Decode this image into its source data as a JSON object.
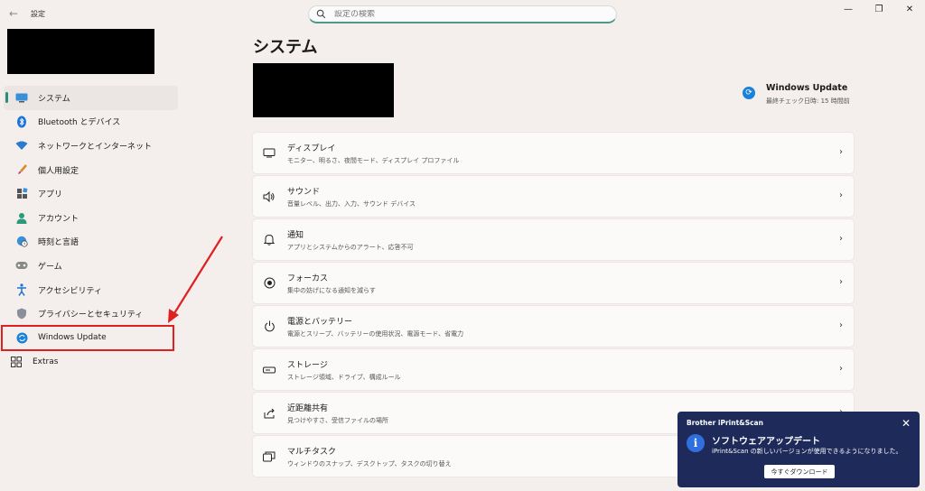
{
  "app": {
    "title": "設定",
    "back_icon": "arrow-left-icon",
    "window_controls": [
      "minimize-icon",
      "maximize-icon",
      "close-icon"
    ]
  },
  "search": {
    "placeholder": "設定の検索",
    "icon": "search-icon"
  },
  "sidebar": {
    "items": [
      {
        "label": "システム",
        "icon": "monitor-icon",
        "active": true
      },
      {
        "label": "Bluetooth とデバイス",
        "icon": "bluetooth-icon"
      },
      {
        "label": "ネットワークとインターネット",
        "icon": "wifi-icon"
      },
      {
        "label": "個人用設定",
        "icon": "brush-icon"
      },
      {
        "label": "アプリ",
        "icon": "apps-icon"
      },
      {
        "label": "アカウント",
        "icon": "person-icon"
      },
      {
        "label": "時刻と言語",
        "icon": "globe-clock-icon"
      },
      {
        "label": "ゲーム",
        "icon": "gamepad-icon"
      },
      {
        "label": "アクセシビリティ",
        "icon": "accessibility-icon"
      },
      {
        "label": "プライバシーとセキュリティ",
        "icon": "shield-icon"
      },
      {
        "label": "Windows Update",
        "icon": "windows-update-icon"
      },
      {
        "label": "Extras",
        "icon": "extras-icon"
      }
    ]
  },
  "main": {
    "title": "システム",
    "windows_update": {
      "title": "Windows Update",
      "subtitle": "最終チェック日時: 15 時間前",
      "icon": "sync-icon"
    },
    "cards": [
      {
        "title": "ディスプレイ",
        "subtitle": "モニター、明るさ、夜間モード、ディスプレイ プロファイル",
        "icon": "display-icon"
      },
      {
        "title": "サウンド",
        "subtitle": "音量レベル、出力、入力、サウンド デバイス",
        "icon": "speaker-icon"
      },
      {
        "title": "通知",
        "subtitle": "アプリとシステムからのアラート、応答不可",
        "icon": "bell-icon"
      },
      {
        "title": "フォーカス",
        "subtitle": "集中の妨げになる通知を減らす",
        "icon": "focus-icon"
      },
      {
        "title": "電源とバッテリー",
        "subtitle": "電源とスリープ、バッテリーの使用状況、電源モード、省電力",
        "icon": "power-icon"
      },
      {
        "title": "ストレージ",
        "subtitle": "ストレージ領域、ドライブ、構成ルール",
        "icon": "storage-icon"
      },
      {
        "title": "近距離共有",
        "subtitle": "見つけやすさ、受信ファイルの場所",
        "icon": "share-icon"
      },
      {
        "title": "マルチタスク",
        "subtitle": "ウィンドウのスナップ、デスクトップ、タスクの切り替え",
        "icon": "multitask-icon"
      }
    ]
  },
  "toast": {
    "app_name": "Brother iPrint&Scan",
    "title": "ソフトウェアアップデート",
    "message": "iPrint&Scan の新しいバージョンが使用できるようになりました。",
    "button_label": "今すぐダウンロード",
    "icon": "info-icon",
    "close_icon": "close-icon"
  },
  "colors": {
    "accent": "#2e8b79",
    "annotation_red": "#e02020",
    "toast_bg": "#1e2a5a"
  }
}
